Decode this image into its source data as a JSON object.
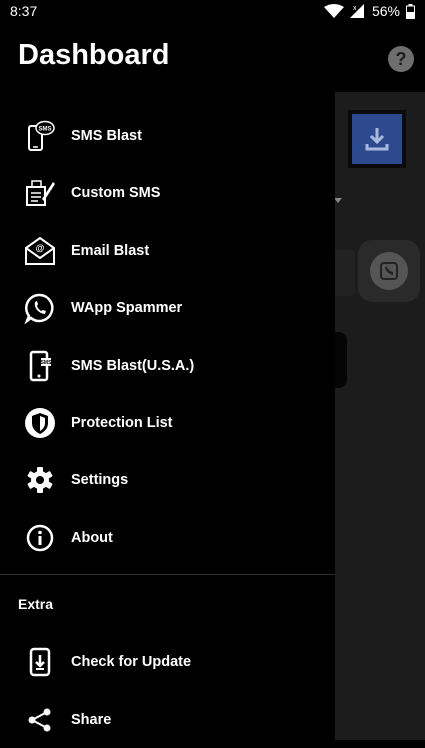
{
  "status_bar": {
    "time": "8:37",
    "battery": "56%"
  },
  "header": {
    "title": "Dashboard"
  },
  "menu": [
    {
      "label": "SMS Blast",
      "icon": "sms-phone-icon"
    },
    {
      "label": "Custom SMS",
      "icon": "custom-sms-icon"
    },
    {
      "label": "Email Blast",
      "icon": "email-envelope-icon"
    },
    {
      "label": "WApp Spammer",
      "icon": "whatsapp-icon"
    },
    {
      "label": "SMS Blast(U.S.A.)",
      "icon": "sms-phone-usa-icon"
    },
    {
      "label": "Protection List",
      "icon": "shield-icon"
    },
    {
      "label": "Settings",
      "icon": "gear-icon"
    },
    {
      "label": "About",
      "icon": "info-icon"
    }
  ],
  "extra": {
    "label": "Extra",
    "items": [
      {
        "label": "Check for Update",
        "icon": "download-update-icon"
      },
      {
        "label": "Share",
        "icon": "share-icon"
      }
    ]
  },
  "background": {
    "help_glyph": "?"
  }
}
